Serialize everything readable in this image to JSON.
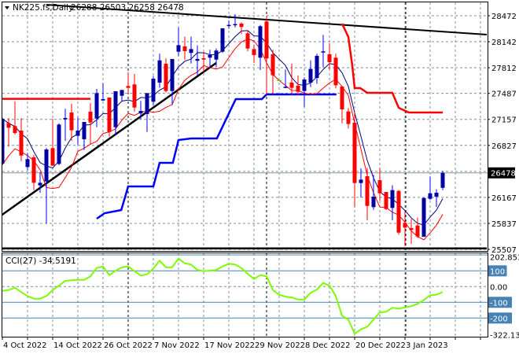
{
  "header": {
    "menu_icon": "triangle-down-icon",
    "symbol": "NK225.fs,Daily",
    "ohlc": "26288 26503 26258 26478"
  },
  "cci_header": {
    "label": "CCI(27) -34.5191"
  },
  "colors": {
    "bull_body": "#0000A0",
    "bull_wick": "#0000FF",
    "bear": "#FF0000",
    "doji": "#00FF00",
    "ma_fast": "#000080",
    "ma_slow": "#FF0000",
    "support_line": "#0000FF",
    "resistance_line": "#FF0000",
    "trendline": "#000000",
    "cci": "#7CFC00",
    "cci_level": "#4682B4",
    "grid": "#7F8C99"
  },
  "chart_data": [
    {
      "type": "candlestick",
      "title": "NK225.fs,Daily",
      "ylim": [
        25507,
        28472
      ],
      "y_ticks": [
        "28472",
        "28142",
        "27812",
        "27487",
        "27157",
        "26827",
        "26167",
        "25837",
        "25507"
      ],
      "y_tick_values": [
        28472,
        28142,
        27812,
        27487,
        27157,
        26827,
        26167,
        25837,
        25507
      ],
      "current_price": "26478",
      "x_labels": [
        "4 Oct 2022",
        "14 Oct 2022",
        "26 Oct 2022",
        "7 Nov 2022",
        "17 Nov 2022",
        "29 Nov 2022",
        "8 Dec 2022",
        "20 Dec 2022",
        "3 Jan 2023"
      ],
      "x_label_every": 8,
      "candles_ohlc": [
        [
          26595,
          27180,
          26580,
          27164
        ],
        [
          27111,
          27174,
          26808,
          27051
        ],
        [
          27071,
          27384,
          26964,
          26984
        ],
        [
          27014,
          27174,
          26625,
          26698
        ],
        [
          26552,
          26732,
          26509,
          26652
        ],
        [
          26675,
          26708,
          26259,
          26352
        ],
        [
          26319,
          26485,
          26226,
          26352
        ],
        [
          26369,
          26792,
          25836,
          26775
        ],
        [
          26792,
          27164,
          26569,
          26569
        ],
        [
          26592,
          27108,
          26575,
          27091
        ],
        [
          27157,
          27291,
          26885,
          27174
        ],
        [
          27244,
          27357,
          26885,
          27018
        ],
        [
          26948,
          27181,
          26841,
          27014
        ],
        [
          26905,
          27124,
          26768,
          27124
        ],
        [
          27254,
          27364,
          26835,
          27118
        ],
        [
          27167,
          27544,
          27058,
          27490
        ],
        [
          27397,
          27617,
          27390,
          27414
        ],
        [
          27434,
          27434,
          26938,
          26998
        ],
        [
          27058,
          27514,
          26958,
          27514
        ],
        [
          27457,
          27530,
          27390,
          27530
        ],
        [
          27580,
          27757,
          27490,
          27557
        ],
        [
          27600,
          27733,
          27257,
          27307
        ],
        [
          27231,
          27391,
          27158,
          27264
        ],
        [
          27224,
          27490,
          26998,
          27490
        ],
        [
          27381,
          27707,
          27331,
          27673
        ],
        [
          27623,
          27990,
          27557,
          27906
        ],
        [
          27863,
          27930,
          27497,
          27517
        ],
        [
          27517,
          27923,
          27341,
          27923
        ],
        [
          28016,
          28322,
          27956,
          28099
        ],
        [
          28083,
          28206,
          27916,
          28023
        ],
        [
          28000,
          28206,
          27866,
          28049
        ],
        [
          27900,
          28096,
          27707,
          27923
        ],
        [
          27933,
          28013,
          27757,
          27916
        ],
        [
          27940,
          28040,
          27823,
          27973
        ],
        [
          27916,
          28056,
          27823,
          28030
        ],
        [
          28016,
          28312,
          28000,
          28312
        ],
        [
          28346,
          28412,
          28306,
          28356
        ],
        [
          28352,
          28489,
          28322,
          28366
        ],
        [
          28372,
          28389,
          28239,
          28329
        ],
        [
          28249,
          28282,
          28023,
          28056
        ],
        [
          28049,
          28106,
          27873,
          27973
        ],
        [
          27940,
          28356,
          27783,
          28339
        ],
        [
          28399,
          28472,
          27474,
          27930
        ],
        [
          27983,
          28040,
          27474,
          27717
        ],
        [
          27650,
          27650,
          27650,
          27650
        ],
        [
          27557,
          27790,
          27557,
          27570
        ],
        [
          27624,
          27863,
          27464,
          27557
        ],
        [
          27584,
          27713,
          27464,
          27507
        ],
        [
          27517,
          27690,
          27314,
          27663
        ],
        [
          27623,
          27906,
          27567,
          27797
        ],
        [
          27683,
          27990,
          27607,
          27963
        ],
        [
          28006,
          28229,
          27817,
          28020
        ],
        [
          27983,
          28123,
          27790,
          27883
        ],
        [
          27940,
          27990,
          27550,
          27590
        ],
        [
          27574,
          27574,
          27107,
          27284
        ],
        [
          27257,
          27301,
          27041,
          27098
        ],
        [
          27114,
          27257,
          26043,
          26349
        ],
        [
          26349,
          26535,
          26166,
          26392
        ],
        [
          26435,
          26542,
          25876,
          26059
        ],
        [
          26043,
          26452,
          26009,
          26176
        ],
        [
          26385,
          26542,
          26126,
          26219
        ],
        [
          26236,
          26236,
          26009,
          26019
        ],
        [
          26033,
          26319,
          25876,
          26259
        ],
        [
          26249,
          26259,
          25693,
          25720
        ],
        [
          25843,
          25986,
          25550,
          25783
        ],
        [
          25776,
          25893,
          25577,
          25753
        ],
        [
          25810,
          25910,
          25653,
          25670
        ],
        [
          25667,
          26166,
          25667,
          26159
        ],
        [
          26149,
          26432,
          26133,
          26219
        ],
        [
          26176,
          26269,
          26043,
          26226
        ],
        [
          26288,
          26503,
          26258,
          26478
        ]
      ],
      "ma_fast": {
        "source": "close",
        "period": 5
      },
      "ma_slow": {
        "source": "low",
        "period": 5
      },
      "resistance_left": {
        "points": [
          [
            0,
            27417
          ],
          [
            14,
            27417
          ]
        ]
      },
      "resistance_step": {
        "points": [
          [
            54,
            28372
          ],
          [
            55,
            28202
          ],
          [
            55.6,
            27853
          ],
          [
            56,
            27554
          ],
          [
            56.9,
            27554
          ],
          [
            58,
            27494
          ],
          [
            62,
            27494
          ],
          [
            63,
            27304
          ],
          [
            64.6,
            27244
          ],
          [
            70,
            27244
          ]
        ]
      },
      "support_step": {
        "points": [
          [
            15,
            25896
          ],
          [
            16.25,
            25966
          ],
          [
            18.9,
            26006
          ],
          [
            20,
            26306
          ],
          [
            24,
            26306
          ],
          [
            25,
            26605
          ],
          [
            27.1,
            26605
          ],
          [
            28,
            26895
          ],
          [
            30,
            26915
          ],
          [
            34.1,
            26915
          ],
          [
            37.1,
            27414
          ],
          [
            41.25,
            27414
          ],
          [
            42,
            27474
          ],
          [
            53.1,
            27474
          ]
        ]
      },
      "uptrend": {
        "points": [
          [
            -0.4,
            25926
          ],
          [
            34,
            27873
          ]
        ]
      },
      "downtrend": {
        "points": [
          [
            7,
            28612
          ],
          [
            77,
            28232
          ]
        ]
      },
      "floor_line": {
        "points": [
          [
            -0.4,
            25520
          ],
          [
            77,
            25520
          ]
        ]
      }
    },
    {
      "type": "line",
      "title": "CCI(27) -34.5191",
      "ylim": [
        -322.133,
        202.8534
      ],
      "y_ticks": [
        "202.8534",
        "100",
        "0.00",
        "-100",
        "-200",
        "-322.133"
      ],
      "levels": [
        100,
        -100,
        -200
      ],
      "values": [
        -27,
        -22,
        -7,
        -35,
        -60,
        -77,
        -77,
        -60,
        -22,
        6,
        36,
        40,
        43,
        43,
        65,
        118,
        128,
        73,
        101,
        123,
        128,
        98,
        70,
        78,
        115,
        165,
        123,
        123,
        178,
        148,
        140,
        106,
        98,
        101,
        106,
        128,
        145,
        140,
        118,
        81,
        48,
        73,
        65,
        -22,
        -52,
        -64,
        -69,
        -82,
        -82,
        -39,
        -19,
        23,
        6,
        -60,
        -185,
        -210,
        -299,
        -272,
        -255,
        -210,
        -164,
        -160,
        -135,
        -140,
        -132,
        -124,
        -110,
        -85,
        -55,
        -52,
        -34.5191
      ]
    }
  ]
}
